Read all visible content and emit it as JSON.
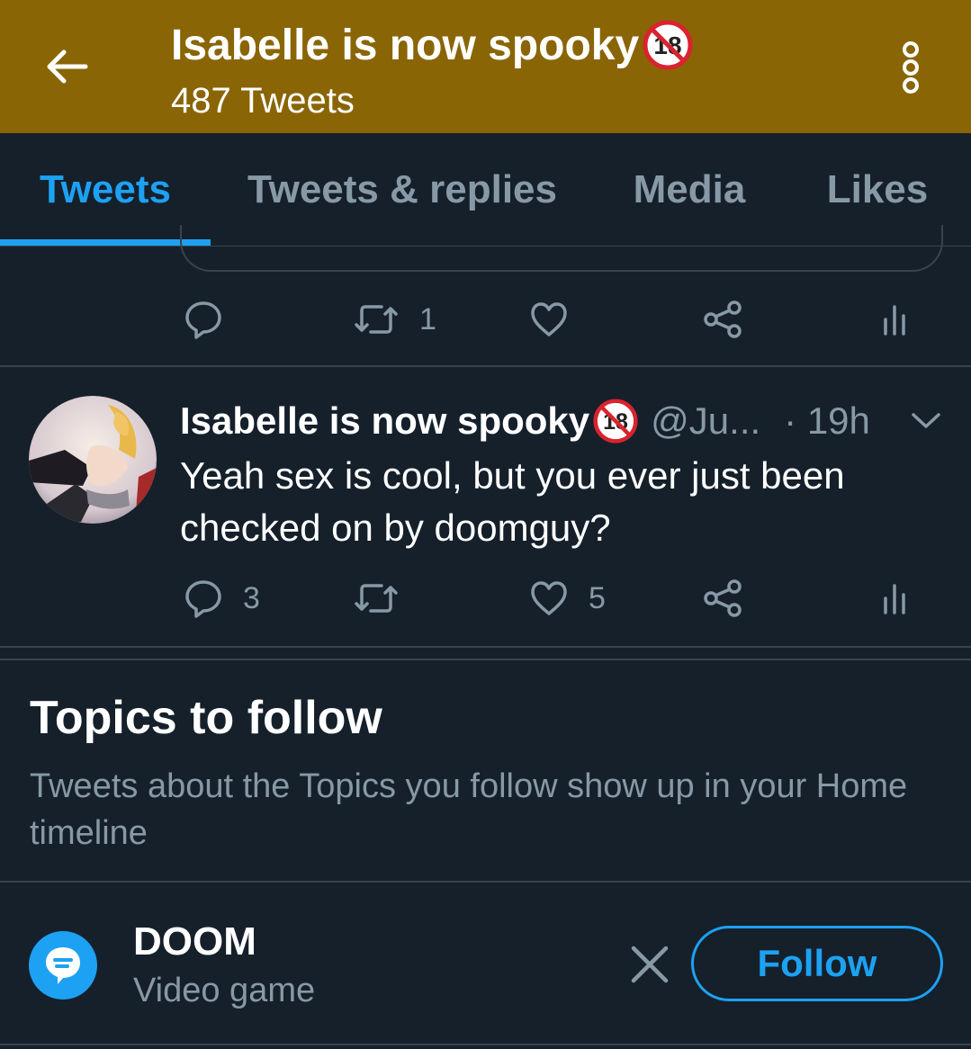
{
  "header": {
    "title": "Isabelle is now spooky",
    "subtitle": "487 Tweets",
    "background": "#8a6506"
  },
  "tabs": [
    {
      "label": "Tweets",
      "active": true
    },
    {
      "label": "Tweets & replies",
      "active": false
    },
    {
      "label": "Media",
      "active": false
    },
    {
      "label": "Likes",
      "active": false
    }
  ],
  "previous_tweet_actions": {
    "reply_count": "",
    "retweet_count": "1",
    "like_count": ""
  },
  "tweet": {
    "name": "Isabelle is now spooky",
    "handle": "@Ju...",
    "time": "· 19h",
    "text": "Yeah sex is cool, but you ever just been checked on by doomguy?",
    "reply_count": "3",
    "retweet_count": "",
    "like_count": "5"
  },
  "topics": {
    "title": "Topics to follow",
    "description": "Tweets about the Topics you follow show up in your Home timeline",
    "items": [
      {
        "name": "DOOM",
        "category": "Video game",
        "follow_label": "Follow"
      }
    ]
  },
  "colors": {
    "accent": "#1da1f2",
    "background": "#15202b",
    "muted": "#8899a6",
    "border": "#38444d"
  }
}
